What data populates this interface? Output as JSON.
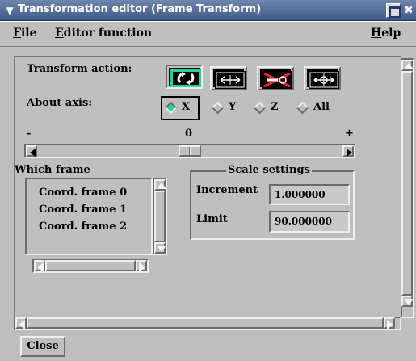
{
  "window": {
    "title": "Transformation editor (Frame Transform)",
    "titlebar_color": "#4a6493",
    "selection_color": "#29cfa2"
  },
  "menubar": {
    "file": {
      "first": "F",
      "rest": "ile"
    },
    "editor": {
      "first": "E",
      "rest": "ditor function"
    },
    "help": {
      "first": "H",
      "rest": "elp"
    }
  },
  "transform_action": {
    "label": "Transform action:",
    "tools": [
      {
        "name": "rotate-tool",
        "icon": "rotate-arrows-icon",
        "selected": true
      },
      {
        "name": "translate-tool",
        "icon": "horizontal-arrows-icon",
        "selected": false
      },
      {
        "name": "stretch-tool",
        "icon": "no-rotate-icon",
        "selected": false
      },
      {
        "name": "scale-tool",
        "icon": "four-way-arrows-icon",
        "selected": false
      }
    ]
  },
  "about_axis": {
    "label": "About axis:",
    "options": [
      "X",
      "Y",
      "Z",
      "All"
    ],
    "selected": "X"
  },
  "slider": {
    "min_label": "-",
    "mid_label": "0",
    "max_label": "+",
    "value_fraction": 0.5
  },
  "which_frame": {
    "label": "Which frame",
    "items": [
      "Coord. frame 0",
      "Coord. frame 1",
      "Coord. frame 2"
    ]
  },
  "scale_settings": {
    "title": "Scale settings",
    "increment_label": "Increment",
    "increment_value": "1.000000",
    "limit_label": "Limit",
    "limit_value": "90.000000"
  },
  "footer": {
    "close_label": "Close"
  }
}
